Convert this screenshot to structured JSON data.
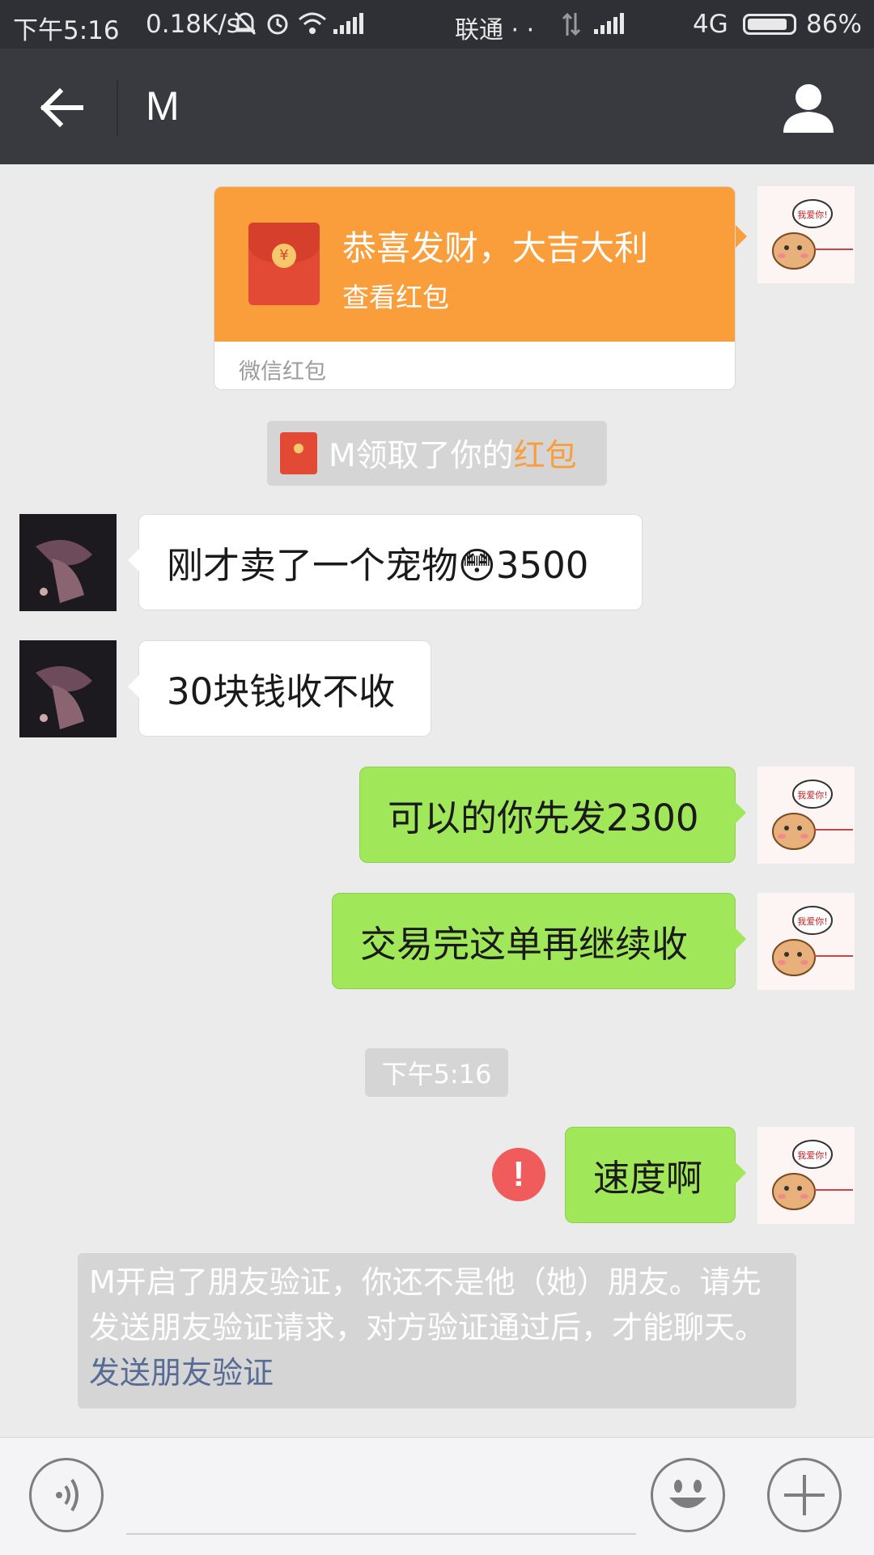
{
  "status_bar": {
    "time": "下午5:16",
    "speed": "0.18K/s",
    "carrier": "联通 · ·",
    "network": "4G",
    "battery": "86%"
  },
  "header": {
    "title": "M"
  },
  "messages": {
    "red_packet": {
      "title": "恭喜发财，大吉大利",
      "subtitle": "查看红包",
      "footer": "微信红包",
      "currency_symbol": "¥"
    },
    "sys_redpacket": {
      "text": "M领取了你的",
      "highlight": "红包"
    },
    "other_1": "刚才卖了一个宠物😳3500",
    "other_2": "30块钱收不收",
    "me_1": "可以的你先发2300",
    "me_2": "交易完这单再继续收",
    "timestamp": "下午5:16",
    "me_3": "速度啊",
    "error_mark": "!",
    "verify_notice": {
      "text": "M开启了朋友验证，你还不是他（她）朋友。请先发送朋友验证请求，对方验证通过后，才能聊天。",
      "link": "发送朋友验证"
    },
    "avatar_caption": "我爱你!"
  },
  "input": {
    "placeholder": ""
  },
  "colors": {
    "status_bar": "#2f3035",
    "title_bar": "#393a3f",
    "chat_bg": "#ebebeb",
    "green_bubble": "#a0e75a",
    "red_packet": "#fa9d3b",
    "error": "#f05b5b",
    "link": "#576b95"
  },
  "icons": [
    "back-arrow-icon",
    "profile-icon",
    "voice-icon",
    "emoji-icon",
    "plus-icon",
    "red-packet-icon",
    "error-icon",
    "alarm-icon",
    "wifi-icon",
    "battery-icon"
  ]
}
